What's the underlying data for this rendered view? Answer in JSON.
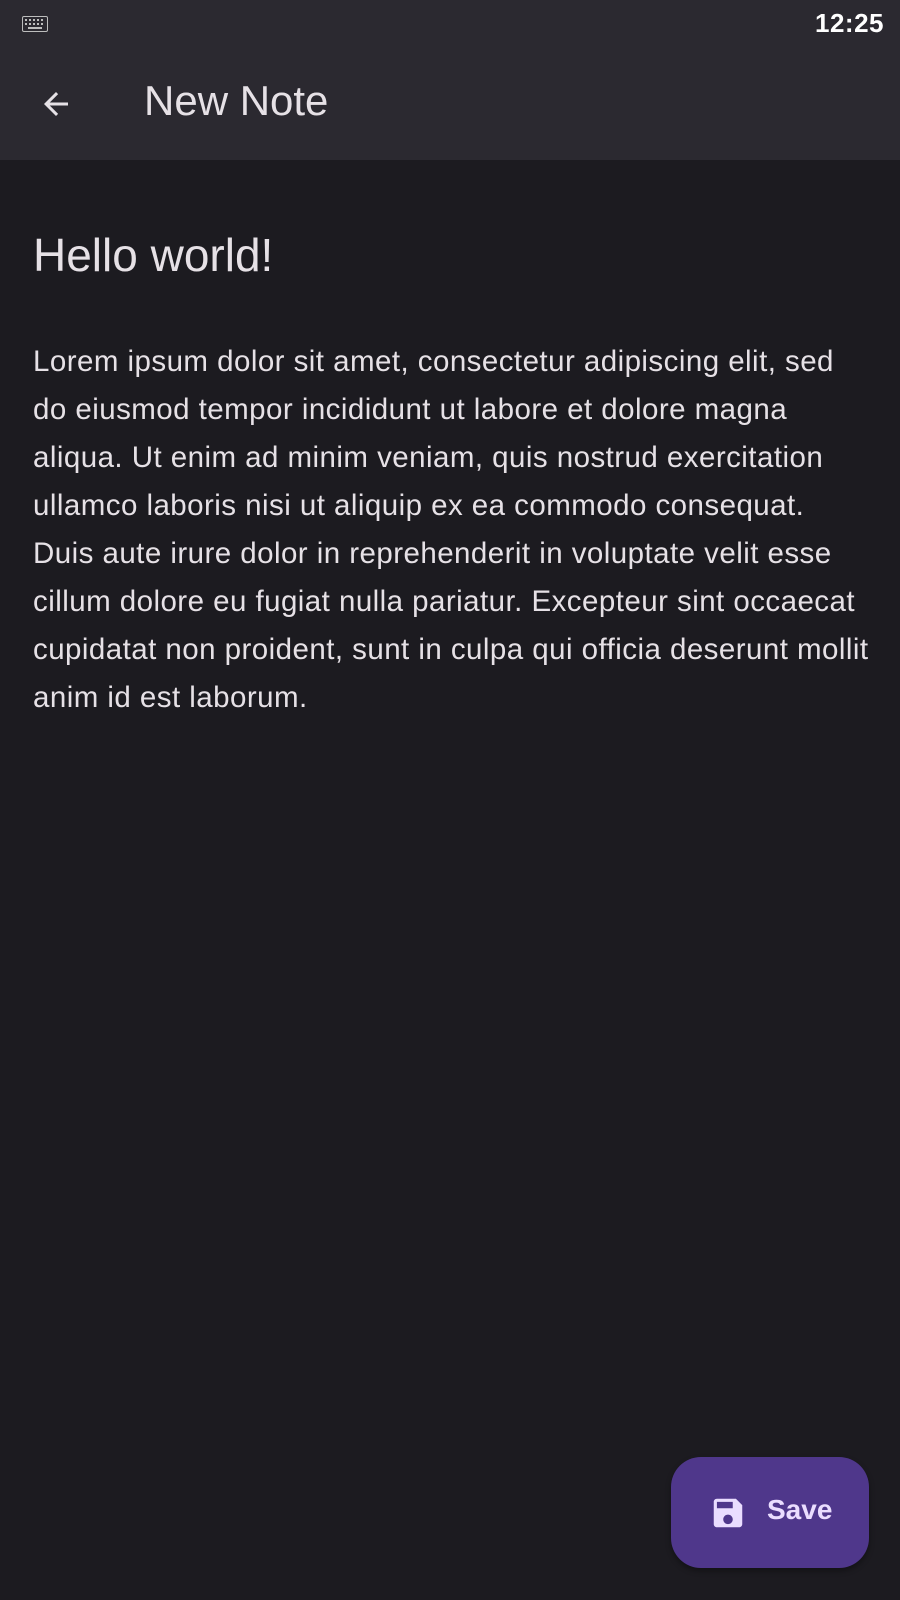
{
  "status_bar": {
    "time": "12:25",
    "left_icon": "keyboard-icon"
  },
  "app_bar": {
    "title": "New Note",
    "back_icon": "arrow-back-icon"
  },
  "note": {
    "title": "Hello world!",
    "body": "Lorem ipsum dolor sit amet, consectetur adipiscing elit, sed do eiusmod tempor incididunt ut labore et dolore magna aliqua. Ut enim ad minim veniam, quis nostrud exercitation ullamco laboris nisi ut aliquip ex ea commodo consequat. Duis aute irure dolor in reprehenderit in voluptate velit esse cillum dolore eu fugiat nulla pariatur. Excepteur sint occaecat cupidatat non proident, sunt in culpa qui officia deserunt mollit anim id est laborum."
  },
  "fab": {
    "label": "Save",
    "icon": "save-icon"
  },
  "colors": {
    "background": "#1c1b20",
    "app_bar": "#2b2930",
    "text": "#e6e1e6",
    "fab_background": "#4f378b",
    "fab_foreground": "#eaddff"
  }
}
